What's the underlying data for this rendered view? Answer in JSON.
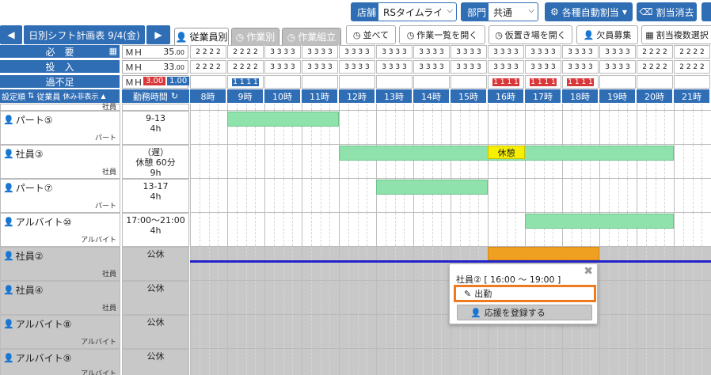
{
  "toolbar": {
    "store_label": "店舗",
    "store_value": "RSタイムライ",
    "dept_label": "部門",
    "dept_value": "共通",
    "auto_assign": "各種自動割当",
    "clear_assign": "割当消去"
  },
  "nav": {
    "prev": "◀",
    "title": "日別シフト計画表 9/4(金)",
    "next": "▶"
  },
  "tabs": [
    "従業員別",
    "作業別",
    "作業組立"
  ],
  "tools": {
    "sort": "並べて",
    "open_tasks": "作業一覧を開く",
    "open_temp": "仮置き場を開く",
    "recruit": "欠員募集",
    "multi_select": "割当複数選択"
  },
  "summary": {
    "required": {
      "label": "必　要",
      "mh": "ＭＨ",
      "value": "35",
      "dec": ".00"
    },
    "input": {
      "label": "投　入",
      "mh": "ＭＨ",
      "value": "33",
      "dec": ".00"
    },
    "diff": {
      "label": "過不足",
      "mh": "ＭＨ",
      "neg": "3.00",
      "pos": "1.00"
    }
  },
  "counts": {
    "required": [
      "2 2 2 2",
      "2 2 2 2",
      "3 3 3 3",
      "3 3 3 3",
      "3 3 3 3",
      "3 3 3 3",
      "3 3 3 3",
      "3 3 3 3",
      "3 3 3 3",
      "3 3 3 3",
      "3 3 3 3",
      "3 3 3 3",
      "2 2 2 2",
      "2 2 2 2"
    ],
    "input": [
      "2 2 2 2",
      "2 2 2 2",
      "3 3 3 3",
      "3 3 3 3",
      "3 3 3 3",
      "3 3 3 3",
      "3 3 3 3",
      "3 3 3 3",
      "3 3 3 3",
      "3 3 3 3",
      "3 3 3 3",
      "3 3 3 3",
      "2 2 2 2",
      "2 2 2 2"
    ],
    "diff_blue": "1 1 1 1",
    "diff_red": "1 1 1 1"
  },
  "header": {
    "settings": "設定順",
    "employee": "従業員",
    "hide_off": "休み非表示",
    "work_time": "勤務時間",
    "hours": [
      "8時",
      "9時",
      "10時",
      "11時",
      "12時",
      "13時",
      "14時",
      "15時",
      "16時",
      "17時",
      "18時",
      "19時",
      "20時",
      "21時"
    ]
  },
  "employees": [
    {
      "name": "パート⑤",
      "role": "パート",
      "time": [
        "9-13",
        "4h"
      ]
    },
    {
      "name": "社員③",
      "role": "社員",
      "time": [
        "（遅）",
        "休憩 60分",
        "9h"
      ],
      "break_label": "休憩"
    },
    {
      "name": "パート⑦",
      "role": "パート",
      "time": [
        "13-17",
        "4h"
      ]
    },
    {
      "name": "アルバイト⑩",
      "role": "アルバイト",
      "time": [
        "17:00～21:00",
        "4h"
      ]
    },
    {
      "name": "社員②",
      "role": "社員",
      "time": [
        "公休"
      ]
    },
    {
      "name": "社員④",
      "role": "社員",
      "time": [
        "公休"
      ]
    },
    {
      "name": "アルバイト⑧",
      "role": "アルバイト",
      "time": [
        "公休"
      ]
    },
    {
      "name": "アルバイト⑨",
      "role": "アルバイト",
      "time": [
        "公休"
      ]
    }
  ],
  "top_row_role": "社員",
  "popup": {
    "title": "社員② [ 16:00 ～ 19:00 ]",
    "attend": "出勤",
    "support": "応援を登録する"
  },
  "colors": {
    "primary": "#2f6db5",
    "shift_bar": "#8fe2ab",
    "break": "#f6f000",
    "highlight": "#f0a020",
    "deficit": "#d9383a"
  }
}
